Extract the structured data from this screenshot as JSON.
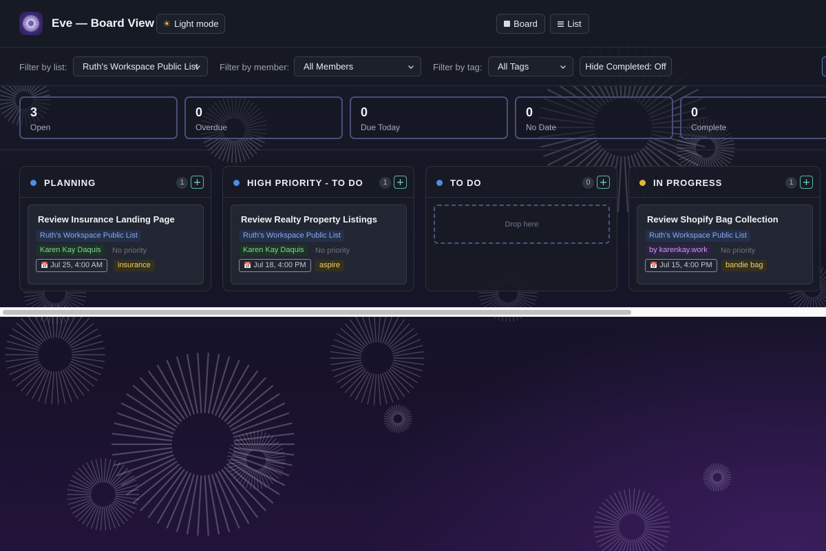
{
  "header": {
    "title": "Eve — Board View",
    "light_mode_label": "Light mode",
    "light_mode_icon": "sun-icon",
    "view_board_label": "Board",
    "view_list_label": "List"
  },
  "filters": {
    "list_label": "Filter by list:",
    "list_value": "Ruth's Workspace Public List",
    "member_label": "Filter by member:",
    "member_value": "All Members",
    "tag_label": "Filter by tag:",
    "tag_value": "All Tags",
    "hide_completed_label": "Hide Completed: Off"
  },
  "stats": [
    {
      "value": "3",
      "label": "Open"
    },
    {
      "value": "0",
      "label": "Overdue"
    },
    {
      "value": "0",
      "label": "Due Today"
    },
    {
      "value": "0",
      "label": "No Date"
    },
    {
      "value": "0",
      "label": "Complete"
    }
  ],
  "columns": [
    {
      "title": "PLANNING",
      "count": "1",
      "dot_color": "#4a8fe0",
      "card": {
        "title": "Review Insurance Landing Page",
        "list": "Ruth's Workspace Public List",
        "member": "Karen Kay Daquis",
        "priority": "No priority",
        "due": "Jul 25, 4:00 AM",
        "tag": "insurance"
      }
    },
    {
      "title": "HIGH PRIORITY - TO DO",
      "count": "1",
      "dot_color": "#4a8fe0",
      "card": {
        "title": "Review Realty Property Listings",
        "list": "Ruth's Workspace Public List",
        "member": "Karen Kay Daquis",
        "priority": "No priority",
        "due": "Jul 18, 4:00 PM",
        "tag": "aspire"
      }
    },
    {
      "title": "TO DO",
      "count": "0",
      "dot_color": "#4a8fe0",
      "drop_label": "Drop here"
    },
    {
      "title": "IN PROGRESS",
      "count": "1",
      "dot_color": "#e3b341",
      "card": {
        "title": "Review Shopify Bag Collection",
        "list": "Ruth's Workspace Public List",
        "member": "by karenkay.work",
        "priority": "No priority",
        "due": "Jul 15, 4:00 PM",
        "tag": "bandie bag"
      }
    }
  ],
  "add_label": "+",
  "colors": {
    "accent_green": "#5cb8a0",
    "tag_yellow": "#f0d06a",
    "list_blue": "#8ea8e6"
  }
}
